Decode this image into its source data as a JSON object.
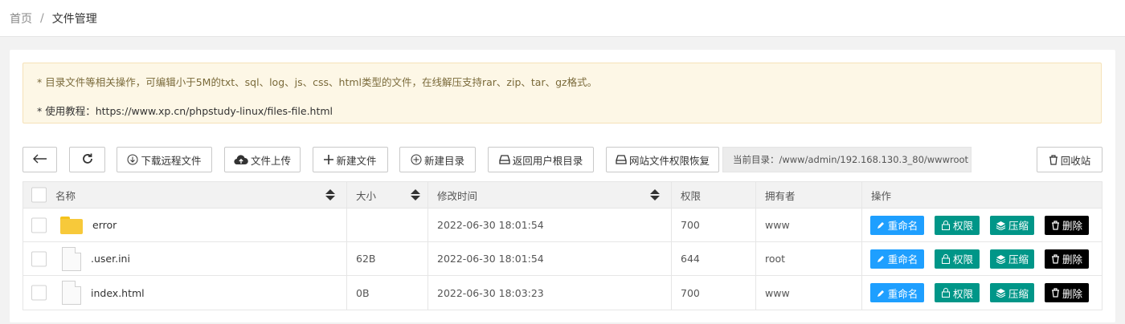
{
  "breadcrumb": {
    "home": "首页",
    "separator": "/",
    "current": "文件管理"
  },
  "notice": {
    "line1": "* 目录文件等相关操作，可编辑小于5M的txt、sql、log、js、css、html类型的文件，在线解压支持rar、zip、tar、gz格式。",
    "line2": "* 使用教程：https://www.xp.cn/phpstudy-linux/files-file.html"
  },
  "toolbar": {
    "download_remote": "下载远程文件",
    "upload": "文件上传",
    "new_file": "新建文件",
    "new_dir": "新建目录",
    "back_root": "返回用户根目录",
    "restore_perm": "网站文件权限恢复",
    "current_dir_label": "当前目录：",
    "current_dir": "/www/admin/192.168.130.3_80/wwwroot",
    "recycle": "回收站"
  },
  "table": {
    "headers": {
      "name": "名称",
      "size": "大小",
      "mtime": "修改时间",
      "perm": "权限",
      "owner": "拥有者",
      "ops": "操作"
    },
    "rows": [
      {
        "type": "folder",
        "name": "error",
        "size": "",
        "mtime": "2022-06-30 18:01:54",
        "perm": "700",
        "owner": "www"
      },
      {
        "type": "file",
        "name": ".user.ini",
        "size": "62B",
        "mtime": "2022-06-30 18:01:54",
        "perm": "644",
        "owner": "root"
      },
      {
        "type": "file",
        "name": "index.html",
        "size": "0B",
        "mtime": "2022-06-30 18:03:23",
        "perm": "700",
        "owner": "www"
      }
    ],
    "actions": {
      "rename": "重命名",
      "perm": "权限",
      "zip": "压缩",
      "delete": "删除"
    }
  },
  "colors": {
    "rename": "#1e9fff",
    "perm": "#009688",
    "zip": "#009688",
    "delete": "#000000",
    "notice_bg": "#fdf7e6"
  }
}
